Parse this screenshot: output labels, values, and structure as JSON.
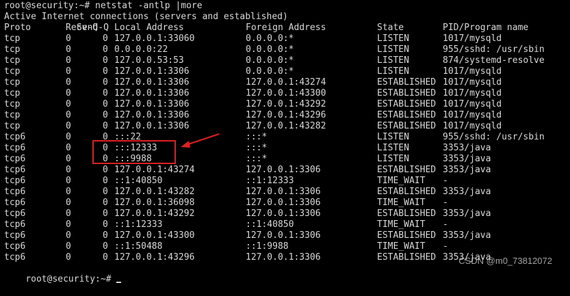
{
  "terminal": {
    "command_line": "root@security:~# netstat -antlp |more",
    "subtitle": "Active Internet connections (servers and established)",
    "headers": {
      "proto": "Proto",
      "recv": "Recv-Q",
      "send": "Send-Q",
      "local": "Local Address",
      "foreign": "Foreign Address",
      "state": "State",
      "pid": "PID/Program name"
    },
    "rows": [
      {
        "proto": "tcp",
        "recv": "0",
        "send": "0",
        "local": "127.0.0.1:33060",
        "foreign": "0.0.0.0:*",
        "state": "LISTEN",
        "pid": "1017/mysqld"
      },
      {
        "proto": "tcp",
        "recv": "0",
        "send": "0",
        "local": "0.0.0.0:22",
        "foreign": "0.0.0.0:*",
        "state": "LISTEN",
        "pid": "955/sshd: /usr/sbin"
      },
      {
        "proto": "tcp",
        "recv": "0",
        "send": "0",
        "local": "127.0.0.53:53",
        "foreign": "0.0.0.0:*",
        "state": "LISTEN",
        "pid": "874/systemd-resolve"
      },
      {
        "proto": "tcp",
        "recv": "0",
        "send": "0",
        "local": "127.0.0.1:3306",
        "foreign": "0.0.0.0:*",
        "state": "LISTEN",
        "pid": "1017/mysqld"
      },
      {
        "proto": "tcp",
        "recv": "0",
        "send": "0",
        "local": "127.0.0.1:3306",
        "foreign": "127.0.0.1:43274",
        "state": "ESTABLISHED",
        "pid": "1017/mysqld"
      },
      {
        "proto": "tcp",
        "recv": "0",
        "send": "0",
        "local": "127.0.0.1:3306",
        "foreign": "127.0.0.1:43300",
        "state": "ESTABLISHED",
        "pid": "1017/mysqld"
      },
      {
        "proto": "tcp",
        "recv": "0",
        "send": "0",
        "local": "127.0.0.1:3306",
        "foreign": "127.0.0.1:43292",
        "state": "ESTABLISHED",
        "pid": "1017/mysqld"
      },
      {
        "proto": "tcp",
        "recv": "0",
        "send": "0",
        "local": "127.0.0.1:3306",
        "foreign": "127.0.0.1:43296",
        "state": "ESTABLISHED",
        "pid": "1017/mysqld"
      },
      {
        "proto": "tcp",
        "recv": "0",
        "send": "0",
        "local": "127.0.0.1:3306",
        "foreign": "127.0.0.1:43282",
        "state": "ESTABLISHED",
        "pid": "1017/mysqld"
      },
      {
        "proto": "tcp6",
        "recv": "0",
        "send": "0",
        "local": ":::22",
        "foreign": ":::*",
        "state": "LISTEN",
        "pid": "955/sshd: /usr/sbin"
      },
      {
        "proto": "tcp6",
        "recv": "0",
        "send": "0",
        "local": ":::12333",
        "foreign": ":::*",
        "state": "LISTEN",
        "pid": "3353/java"
      },
      {
        "proto": "tcp6",
        "recv": "0",
        "send": "0",
        "local": ":::9988",
        "foreign": ":::*",
        "state": "LISTEN",
        "pid": "3353/java"
      },
      {
        "proto": "tcp6",
        "recv": "0",
        "send": "0",
        "local": "127.0.0.1:43274",
        "foreign": "127.0.0.1:3306",
        "state": "ESTABLISHED",
        "pid": "3353/java"
      },
      {
        "proto": "tcp6",
        "recv": "0",
        "send": "0",
        "local": "::1:40850",
        "foreign": "::1:12333",
        "state": "TIME_WAIT",
        "pid": "-"
      },
      {
        "proto": "tcp6",
        "recv": "0",
        "send": "0",
        "local": "127.0.0.1:43282",
        "foreign": "127.0.0.1:3306",
        "state": "ESTABLISHED",
        "pid": "3353/java"
      },
      {
        "proto": "tcp6",
        "recv": "0",
        "send": "0",
        "local": "127.0.0.1:36098",
        "foreign": "127.0.0.1:3306",
        "state": "TIME_WAIT",
        "pid": "-"
      },
      {
        "proto": "tcp6",
        "recv": "0",
        "send": "0",
        "local": "127.0.0.1:43292",
        "foreign": "127.0.0.1:3306",
        "state": "ESTABLISHED",
        "pid": "3353/java"
      },
      {
        "proto": "tcp6",
        "recv": "0",
        "send": "0",
        "local": "::1:12333",
        "foreign": "::1:40850",
        "state": "TIME_WAIT",
        "pid": "-"
      },
      {
        "proto": "tcp6",
        "recv": "0",
        "send": "0",
        "local": "127.0.0.1:43300",
        "foreign": "127.0.0.1:3306",
        "state": "ESTABLISHED",
        "pid": "3353/java"
      },
      {
        "proto": "tcp6",
        "recv": "0",
        "send": "0",
        "local": "::1:50488",
        "foreign": "::1:9988",
        "state": "TIME_WAIT",
        "pid": "-"
      },
      {
        "proto": "tcp6",
        "recv": "0",
        "send": "0",
        "local": "127.0.0.1:43296",
        "foreign": "127.0.0.1:3306",
        "state": "ESTABLISHED",
        "pid": "3353/java"
      }
    ],
    "prompt": "root@security:~# "
  },
  "annotation": {
    "color": "#e02020"
  },
  "watermark": {
    "text": "CSDN @m0_73812072"
  },
  "colors": {
    "background": "#000000",
    "text": "#d8d8d8"
  }
}
